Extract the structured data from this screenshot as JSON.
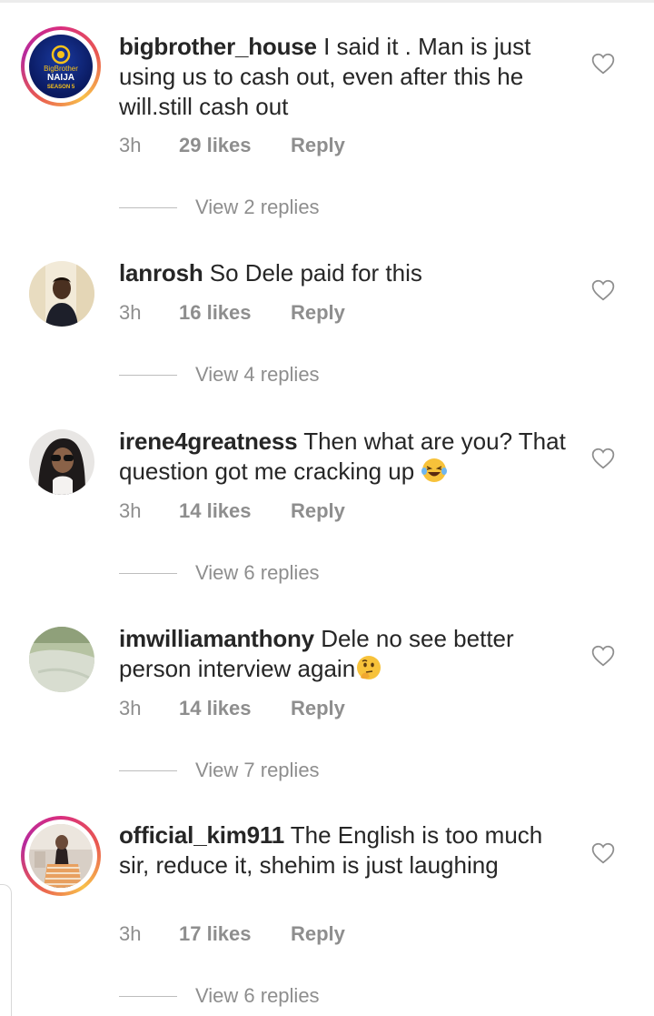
{
  "comments": [
    {
      "username": "bigbrother_house",
      "text": "I said it . Man is just using us to cash out, even after this he will.still cash out",
      "time": "3h",
      "likes": "29 likes",
      "reply": "Reply",
      "view_replies": "View 2 replies",
      "avatar_text": [
        "BigBrother",
        "NAIJA",
        "SEASON 5"
      ]
    },
    {
      "username": "lanrosh",
      "text": "So Dele paid for this",
      "time": "3h",
      "likes": "16 likes",
      "reply": "Reply",
      "view_replies": "View 4 replies"
    },
    {
      "username": "irene4greatness",
      "text": "Then what are you? That question got me cracking up",
      "emoji": "laughing-tears-emoji",
      "time": "3h",
      "likes": "14 likes",
      "reply": "Reply",
      "view_replies": "View 6 replies"
    },
    {
      "username": "imwilliamanthony",
      "text": "Dele no see better person interview again",
      "emoji": "thinking-face-emoji",
      "time": "3h",
      "likes": "14 likes",
      "reply": "Reply",
      "view_replies": "View 7 replies"
    },
    {
      "username": "official_kim911",
      "text": "The English is too much sir, reduce it, shehim is just laughing",
      "time": "3h",
      "likes": "17 likes",
      "reply": "Reply",
      "view_replies": "View 6 replies"
    }
  ],
  "colors": {
    "meta": "#8e8e8e",
    "text": "#262626",
    "story_ring": "#d92e7f"
  }
}
